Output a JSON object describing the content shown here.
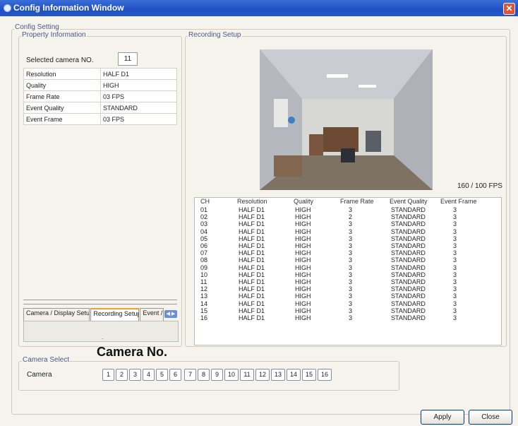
{
  "window": {
    "title": "Config Information Window",
    "close_glyph": "✕"
  },
  "config_setting_label": "Config Setting",
  "property": {
    "label": "Property Information",
    "selected_camera_label": "Selected camera NO.",
    "selected_camera_value": "11",
    "rows": [
      {
        "key": "Resolution",
        "value": "HALF D1"
      },
      {
        "key": "Quality",
        "value": "HIGH"
      },
      {
        "key": "Frame Rate",
        "value": "03 FPS"
      },
      {
        "key": "Event Quality",
        "value": "STANDARD"
      },
      {
        "key": "Event Frame",
        "value": "03 FPS"
      }
    ]
  },
  "tabs": [
    "Camera / Display Setup",
    "Recording Setup",
    "Event / Mo"
  ],
  "tab_scroll": "◀ ▶",
  "tab_panel_mark": "-",
  "recording": {
    "label": "Recording Setup",
    "fps_text": "160 / 100 FPS",
    "columns": [
      "CH",
      "Resolution",
      "Quality",
      "Frame Rate",
      "Event Quality",
      "Event Frame"
    ],
    "rows": [
      [
        "01",
        "HALF D1",
        "HIGH",
        "3",
        "STANDARD",
        "3"
      ],
      [
        "02",
        "HALF D1",
        "HIGH",
        "2",
        "STANDARD",
        "3"
      ],
      [
        "03",
        "HALF D1",
        "HIGH",
        "3",
        "STANDARD",
        "3"
      ],
      [
        "04",
        "HALF D1",
        "HIGH",
        "3",
        "STANDARD",
        "3"
      ],
      [
        "05",
        "HALF D1",
        "HIGH",
        "3",
        "STANDARD",
        "3"
      ],
      [
        "06",
        "HALF D1",
        "HIGH",
        "3",
        "STANDARD",
        "3"
      ],
      [
        "07",
        "HALF D1",
        "HIGH",
        "3",
        "STANDARD",
        "3"
      ],
      [
        "08",
        "HALF D1",
        "HIGH",
        "3",
        "STANDARD",
        "3"
      ],
      [
        "09",
        "HALF D1",
        "HIGH",
        "3",
        "STANDARD",
        "3"
      ],
      [
        "10",
        "HALF D1",
        "HIGH",
        "3",
        "STANDARD",
        "3"
      ],
      [
        "11",
        "HALF D1",
        "HIGH",
        "3",
        "STANDARD",
        "3"
      ],
      [
        "12",
        "HALF D1",
        "HIGH",
        "3",
        "STANDARD",
        "3"
      ],
      [
        "13",
        "HALF D1",
        "HIGH",
        "3",
        "STANDARD",
        "3"
      ],
      [
        "14",
        "HALF D1",
        "HIGH",
        "3",
        "STANDARD",
        "3"
      ],
      [
        "15",
        "HALF D1",
        "HIGH",
        "3",
        "STANDARD",
        "3"
      ],
      [
        "16",
        "HALF D1",
        "HIGH",
        "3",
        "STANDARD",
        "3"
      ]
    ]
  },
  "camera_notice": "Camera No.",
  "camera_select": {
    "label": "Camera Select",
    "camera_label": "Camera",
    "buttons": [
      "1",
      "2",
      "3",
      "4",
      "5",
      "6",
      "7",
      "8",
      "9",
      "10",
      "11",
      "12",
      "13",
      "14",
      "15",
      "16"
    ]
  },
  "actions": {
    "apply": "Apply",
    "close": "Close"
  }
}
